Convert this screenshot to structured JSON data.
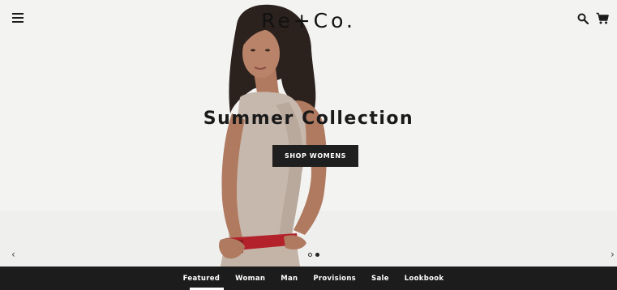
{
  "header": {
    "logo": "Re+Co.",
    "menu_icon": "hamburger-menu-icon",
    "search_icon": "search-icon",
    "cart_icon": "shopping-cart-icon"
  },
  "hero": {
    "title": "Summer Collection",
    "cta_label": "SHOP WOMENS",
    "prev_arrow": "‹",
    "next_arrow": "›",
    "slides_total": 2,
    "active_slide": 2
  },
  "nav": {
    "items": [
      {
        "label": "Featured",
        "active": true
      },
      {
        "label": "Woman",
        "active": false
      },
      {
        "label": "Man",
        "active": false
      },
      {
        "label": "Provisions",
        "active": false
      },
      {
        "label": "Sale",
        "active": false
      },
      {
        "label": "Lookbook",
        "active": false
      }
    ]
  },
  "colors": {
    "nav_background": "#1c1c1c",
    "cta_background": "#1f1f1f",
    "hero_background": "#f4f4f3",
    "accent_belt": "#b3222a"
  }
}
